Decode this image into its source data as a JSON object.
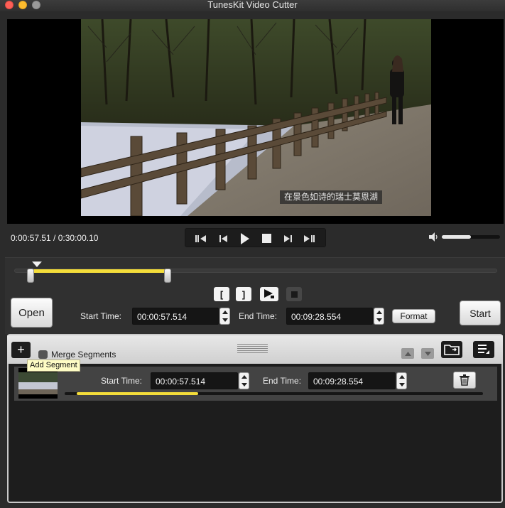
{
  "window": {
    "title": "TunesKit Video Cutter"
  },
  "player": {
    "subtitle": "在景色如诗的瑞士莫恩湖",
    "timecode": "0:00:57.51 / 0:30:00.10",
    "volume_fraction": 0.5,
    "transport": [
      {
        "name": "skip-to-start-button",
        "icon": "skip-start-icon"
      },
      {
        "name": "step-back-button",
        "icon": "step-back-icon"
      },
      {
        "name": "play-button",
        "icon": "play-icon"
      },
      {
        "name": "stop-button",
        "icon": "stop-icon"
      },
      {
        "name": "step-forward-button",
        "icon": "step-forward-icon"
      },
      {
        "name": "skip-to-end-button",
        "icon": "skip-end-icon"
      }
    ]
  },
  "editor": {
    "selection_start_fraction": 0.032,
    "selection_end_fraction": 0.318,
    "cut_buttons": {
      "set_start": "[",
      "set_end": "]"
    },
    "open_label": "Open",
    "start_label": "Start",
    "format_label": "Format",
    "start_time_label": "Start Time:",
    "start_time_value": "00:00:57.514",
    "end_time_label": "End Time:",
    "end_time_value": "00:09:28.554"
  },
  "segments": {
    "add_symbol": "+",
    "add_tooltip": "Add Segment",
    "merge_label": "Merge Segments",
    "merge_checked": false,
    "items": [
      {
        "start_time_label": "Start Time:",
        "start_time_value": "00:00:57.514",
        "end_time_label": "End Time:",
        "end_time_value": "00:09:28.554",
        "progress_fraction": 0.29
      }
    ]
  },
  "colors": {
    "accent_yellow": "#f4dd3a",
    "close": "#fc5f57",
    "minimize": "#fdbc2e"
  }
}
